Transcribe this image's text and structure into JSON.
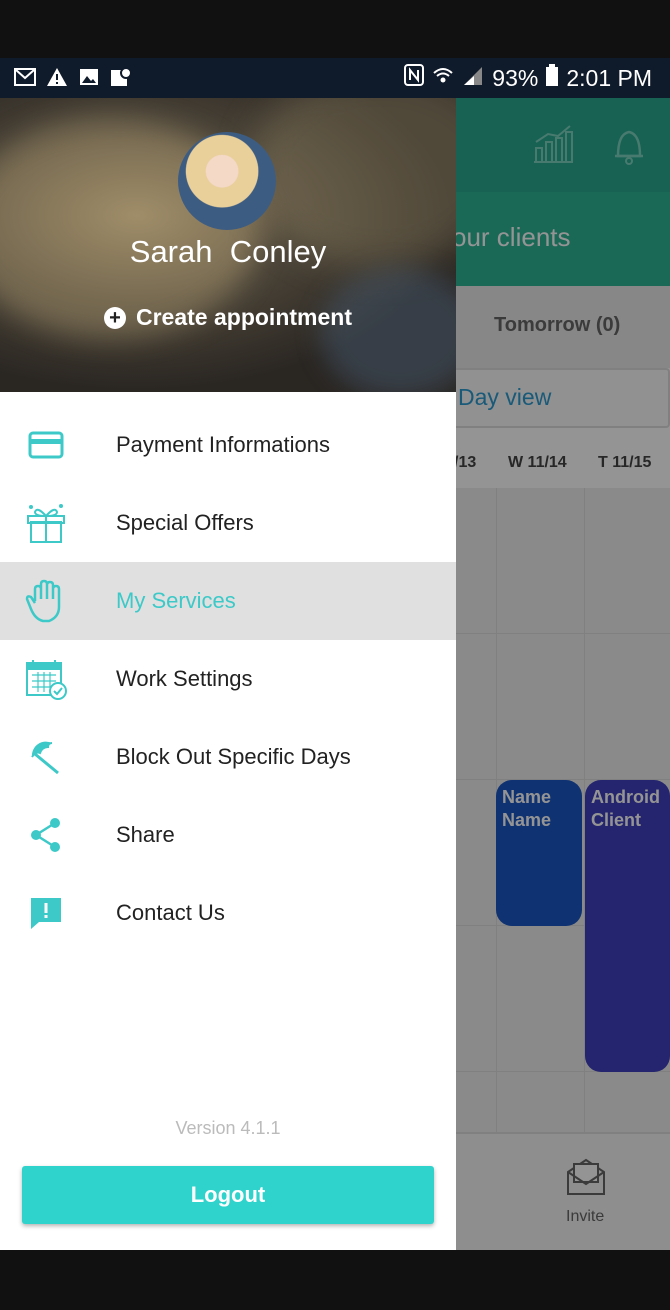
{
  "status_bar": {
    "battery": "93%",
    "time": "2:01 PM"
  },
  "drawer": {
    "user_name": "Sarah  Conley",
    "create_appointment": "Create appointment",
    "menu": [
      {
        "label": "Payment Informations",
        "icon": "credit-card-icon"
      },
      {
        "label": "Special Offers",
        "icon": "gift-icon"
      },
      {
        "label": "My Services",
        "icon": "hand-icon"
      },
      {
        "label": "Work Settings",
        "icon": "calendar-check-icon"
      },
      {
        "label": "Block Out Specific Days",
        "icon": "umbrella-icon"
      },
      {
        "label": "Share",
        "icon": "share-icon"
      },
      {
        "label": "Contact Us",
        "icon": "feedback-icon"
      }
    ],
    "active_item": "My Services",
    "version": "Version 4.1.1",
    "logout": "Logout"
  },
  "background": {
    "banner_text": "our clients",
    "tab_tomorrow": "Tomorrow (0)",
    "day_view": "Day view",
    "days": [
      "/13",
      "W 11/14",
      "T 11/15"
    ],
    "appointments": [
      {
        "line1": "Name",
        "line2": "Name"
      },
      {
        "line1": "Android",
        "line2": "Client"
      }
    ],
    "invite": "Invite"
  },
  "colors": {
    "accent": "#3cc9c8",
    "logout": "#2fd3cb",
    "header_green": "#28a98f"
  }
}
